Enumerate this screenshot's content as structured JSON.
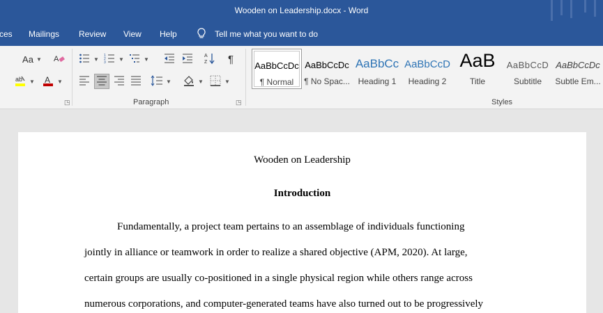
{
  "window": {
    "title": "Wooden on Leadership.docx  -  Word"
  },
  "ribbon_tabs": [
    {
      "label": "ces"
    },
    {
      "label": "Mailings"
    },
    {
      "label": "Review"
    },
    {
      "label": "View"
    },
    {
      "label": "Help"
    }
  ],
  "tell_me": {
    "placeholder": "Tell me what you want to do"
  },
  "groups": {
    "paragraph": "Paragraph",
    "styles": "Styles"
  },
  "font_controls": {
    "change_case": "Aa"
  },
  "styles": [
    {
      "preview": "AaBbCcDc",
      "name": "¶ Normal",
      "selected": true
    },
    {
      "preview": "AaBbCcDc",
      "name": "¶ No Spac..."
    },
    {
      "preview": "AaBbCc",
      "name": "Heading 1"
    },
    {
      "preview": "AaBbCcD",
      "name": "Heading 2"
    },
    {
      "preview": "AaB",
      "name": "Title"
    },
    {
      "preview": "AaBbCcD",
      "name": "Subtitle"
    },
    {
      "preview": "AaBbCcDc",
      "name": "Subtle Em..."
    }
  ],
  "document": {
    "title": "Wooden on Leadership",
    "heading": "Introduction",
    "lines": [
      "Fundamentally, a project team pertains to an assemblage of individuals functioning",
      "jointly in alliance or teamwork in order to realize a shared objective (APM, 2020). At large,",
      "certain groups are usually co-positioned in a single physical region while others range across",
      "numerous corporations, and computer-generated teams have also turned out to be progressively"
    ]
  },
  "colors": {
    "accent": "#2b579a",
    "highlight": "#ffff00",
    "font_color": "#c00000"
  }
}
